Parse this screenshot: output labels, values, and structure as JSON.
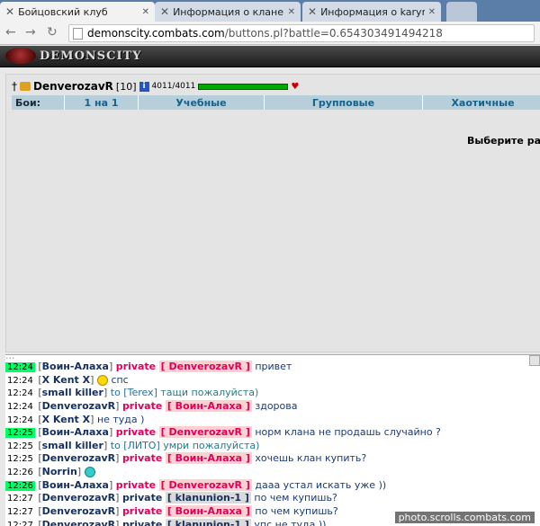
{
  "browser": {
    "tabs": [
      {
        "title": "Бойцовский клуб",
        "close": "✕"
      },
      {
        "title": "Информация о клане Ne",
        "close": "✕"
      },
      {
        "title": "Информация о karyna",
        "close": "✕"
      }
    ],
    "url_host": "demonscity.combats.com",
    "url_path": "/buttons.pl?battle=0.654303491494218"
  },
  "site": {
    "logo": "DEMONSCITY"
  },
  "player": {
    "name": "DenverozavR",
    "level": "[10]",
    "hp": "4011/4011",
    "hp_fraction": 1.0
  },
  "battle_tabs": {
    "label": "Бои:",
    "tabs": [
      "1 на 1",
      "Учебные",
      "Групповые",
      "Хаотичные"
    ]
  },
  "prompt": "Выберите ра",
  "chat": {
    "cut_line": "...",
    "messages": [
      {
        "time": "12:24",
        "hl": true,
        "sender": "Воин-Алаха",
        "private": "private",
        "to_user": "DenverozavR",
        "text": "привет"
      },
      {
        "time": "12:24",
        "hl": false,
        "sender": "X Kent X",
        "smiley": true,
        "text": "спс"
      },
      {
        "time": "12:24",
        "hl": false,
        "sender": "small killer",
        "to": "to",
        "to_user": "Terex",
        "text": "тащи пожалуйста)"
      },
      {
        "time": "12:24",
        "hl": false,
        "sender": "DenverozavR",
        "private": "private",
        "to_user": "Воин-Алаха",
        "text": "здорова"
      },
      {
        "time": "12:24",
        "hl": false,
        "sender": "X Kent X",
        "text": "не туда )"
      },
      {
        "time": "12:25",
        "hl": true,
        "sender": "Воин-Алаха",
        "private": "private",
        "to_user": "DenverozavR",
        "text": "норм клана не продашь случайно ?"
      },
      {
        "time": "12:25",
        "hl": false,
        "sender": "small killer",
        "to": "to",
        "to_user": "ЛИТО",
        "text": "умри пожалуйста)"
      },
      {
        "time": "12:25",
        "hl": false,
        "sender": "DenverozavR",
        "private": "private",
        "to_user": "Воин-Алаха",
        "text": "хочешь клан купить?"
      },
      {
        "time": "12:26",
        "hl": false,
        "sender": "Norrin",
        "smiley2": true,
        "text": ""
      },
      {
        "time": "12:26",
        "hl": true,
        "sender": "Воин-Алаха",
        "private": "private",
        "to_user": "DenverozavR",
        "text": "дааа устал искать уже ))"
      },
      {
        "time": "12:27",
        "hl": false,
        "sender": "DenverozavR",
        "private": "private",
        "to_user": "klanunion-1",
        "dark": true,
        "text": "по чем купишь?"
      },
      {
        "time": "12:27",
        "hl": false,
        "sender": "DenverozavR",
        "private": "private",
        "to_user": "Воин-Алаха",
        "text": "по чем купишь?"
      },
      {
        "time": "12:27",
        "hl": false,
        "sender": "DenverozavR",
        "private": "private",
        "to_user": "klanunion-1",
        "dark": true,
        "text": "упс не туда ))"
      }
    ]
  },
  "watermark": "photo.scrolls.combats.com"
}
